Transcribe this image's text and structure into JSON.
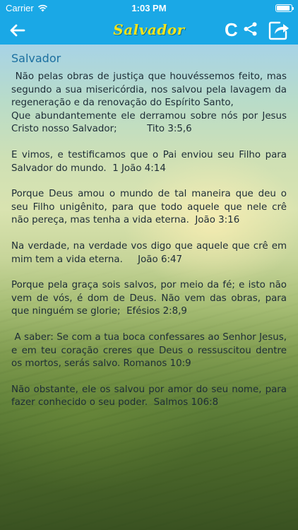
{
  "status_bar": {
    "carrier": "Carrier",
    "time": "1:03 PM",
    "battery_level": 0.9,
    "icons": [
      "wifi-icon",
      "battery-icon"
    ]
  },
  "nav": {
    "title": "Salvador",
    "c_label": "C",
    "icons": [
      "back-arrow-icon",
      "share-icon",
      "export-icon"
    ],
    "bar_color": "#1aa8e6",
    "title_color": "#f2e41c"
  },
  "content": {
    "heading": "Salvador",
    "verses": [
      " Não pelas obras de justiça que houvéssemos feito, mas segundo a sua misericórdia, nos salvou pela lavagem da regeneração e da renovação do Espírito Santo,\nQue abundantemente ele derramou sobre nós por Jesus Cristo nosso Salvador;          Tito 3:5,6",
      "E vimos, e testificamos que o Pai enviou seu Filho para Salvador do mundo.  1 João 4:14",
      "Porque Deus amou o mundo de tal maneira que deu o seu Filho unigênito, para que todo aquele que nele crê não pereça, mas tenha a vida eterna.  João 3:16",
      "Na verdade, na verdade vos digo que aquele que crê em mim tem a vida eterna.     João 6:47",
      "Porque pela graça sois salvos, por meio da fé; e isto não vem de vós, é dom de Deus. Não vem das obras, para que ninguém se glorie;  Efésios 2:8,9",
      " A saber: Se com a tua boca confessares ao Senhor Jesus, e em teu coração creres que Deus o ressuscitou dentre os mortos, serás salvo. Romanos 10:9",
      "Não obstante, ele os salvou por amor do seu nome, para fazer conhecido o seu poder.  Salmos 106:8"
    ]
  }
}
